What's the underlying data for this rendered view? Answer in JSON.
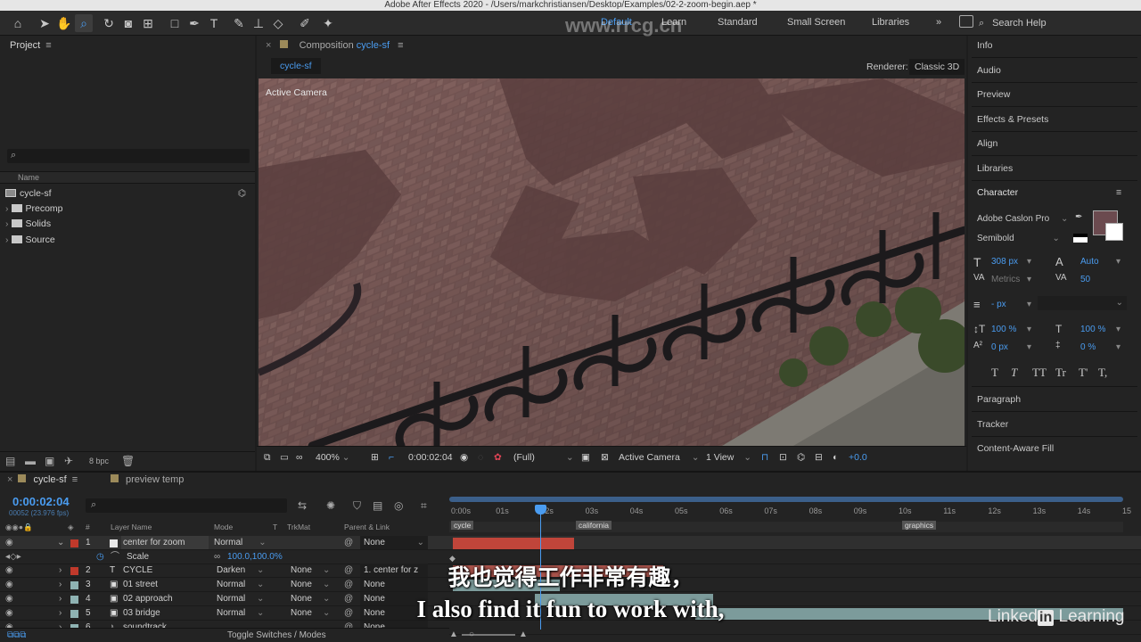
{
  "window": {
    "title": "Adobe After Effects 2020 - /Users/markchristiansen/Desktop/Examples/02-2-zoom-begin.aep *"
  },
  "workspaces": [
    {
      "label": "Default"
    },
    {
      "label": "Learn"
    },
    {
      "label": "Standard"
    },
    {
      "label": "Small Screen"
    },
    {
      "label": "Libraries"
    }
  ],
  "search": {
    "placeholder": "Search Help"
  },
  "project": {
    "tab_label": "Project",
    "column_name": "Name",
    "items": [
      {
        "label": "cycle-sf",
        "type": "composition"
      },
      {
        "label": "Precomp",
        "type": "folder"
      },
      {
        "label": "Solids",
        "type": "folder"
      },
      {
        "label": "Source",
        "type": "folder"
      }
    ],
    "bpc": "8 bpc"
  },
  "composition": {
    "tab_prefix": "Composition",
    "tab_name": "cycle-sf",
    "subtab": "cycle-sf",
    "renderer_label": "Renderer:",
    "renderer_value": "Classic 3D",
    "viewer_label": "Active Camera",
    "zoom": "400%",
    "timecode": "0:00:02:04",
    "resolution": "(Full)",
    "camera": "Active Camera",
    "views": "1 View",
    "exposure": "+0.0"
  },
  "right_panel": {
    "items": [
      "Info",
      "Audio",
      "Preview",
      "Effects & Presets",
      "Align",
      "Libraries"
    ],
    "character": {
      "title": "Character",
      "font": "Adobe Caslon Pro",
      "style": "Semibold",
      "size": "308 px",
      "leading": "Auto",
      "kerning": "Metrics",
      "tracking": "50",
      "stroke_width": "- px",
      "vscale": "100 %",
      "hscale": "100 %",
      "baseline": "0 px",
      "tsume": "0 %",
      "text_styles": [
        "T",
        "T",
        "TT",
        "Tr",
        "T'",
        "T,"
      ],
      "fill_color": "#6b4a4f"
    },
    "lower_items": [
      "Paragraph",
      "Tracker",
      "Content-Aware Fill"
    ]
  },
  "timeline": {
    "tabs": [
      {
        "label": "cycle-sf"
      },
      {
        "label": "preview temp"
      }
    ],
    "timecode": "0:00:02:04",
    "frame_info": "00052 (23.976 fps)",
    "columns": {
      "layer_name": "Layer Name",
      "mode": "Mode",
      "t": "T",
      "trkmat": "TrkMat",
      "parent": "Parent & Link",
      "num": "#"
    },
    "ruler": [
      "0:00s",
      "01s",
      "02s",
      "03s",
      "04s",
      "05s",
      "06s",
      "07s",
      "08s",
      "09s",
      "10s",
      "11s",
      "12s",
      "13s",
      "14s",
      "15"
    ],
    "markers": [
      "cycle",
      "california",
      "graphics"
    ],
    "layers": [
      {
        "num": "1",
        "name": "center for zoom",
        "mode": "Normal",
        "trkmat": "",
        "parent": "None",
        "color": "#c0392b",
        "type": "null"
      },
      {
        "num": "",
        "name": "Scale",
        "value": "100.0,100.0%",
        "property": true
      },
      {
        "num": "2",
        "name": "CYCLE",
        "mode": "Darken",
        "trkmat": "None",
        "parent": "1. center for z",
        "color": "#c0392b",
        "type": "text"
      },
      {
        "num": "3",
        "name": "01 street",
        "mode": "Normal",
        "trkmat": "None",
        "parent": "None",
        "color": "#8fb3b3",
        "type": "comp"
      },
      {
        "num": "4",
        "name": "02 approach",
        "mode": "Normal",
        "trkmat": "None",
        "parent": "None",
        "color": "#8fb3b3",
        "type": "comp"
      },
      {
        "num": "5",
        "name": "03 bridge",
        "mode": "Normal",
        "trkmat": "None",
        "parent": "None",
        "color": "#8fb3b3",
        "type": "comp"
      },
      {
        "num": "6",
        "name": "soundtrack",
        "mode": "",
        "trkmat": "",
        "parent": "None",
        "color": "#8fb3b3",
        "type": "audio"
      }
    ],
    "toggle_label": "Toggle Switches / Modes",
    "playhead_time_fraction": 0.19
  },
  "overlay": {
    "subtitle_cn": "我也觉得工作非常有趣，",
    "subtitle_en": "I also find it fun to work with,",
    "watermark": "www.rrcg.cn",
    "brand": "Linked",
    "brand_box": "in",
    "brand_suffix": "Learning"
  }
}
